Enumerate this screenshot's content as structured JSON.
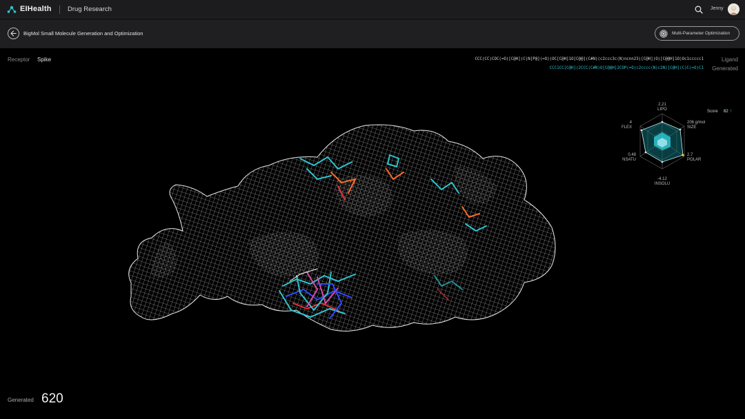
{
  "header": {
    "brand": "EIHealth",
    "app_name": "Drug Research",
    "user_name": "Jenny"
  },
  "subheader": {
    "title": "BigMol Small Molecule Generation and Optimization",
    "mpo_button_label": "Multi-Parameter Optimization"
  },
  "receptor": {
    "label": "Receptor",
    "value": "Spike"
  },
  "smiles": {
    "ligand": "CCC(CC)COC(=O)[C@H](C)N[P@](=O)(OC[C@H]1O[C@@](C#N)(c2ccc3c(N)ncnn23)[C@H](O)[C@@H]1O)Oc1ccccc1",
    "ligand_label": "Ligand",
    "generated": "CCC1CC[C@H](2CCC(C#N)O[C@@H]2COP(=O)c2cccc(N)c2N)[C@H](C)C(=O)C1",
    "generated_label": "Generated"
  },
  "properties": {
    "lipo": {
      "label": "LIPO",
      "value": "2.21"
    },
    "size": {
      "label": "SIZE",
      "value": "206 g/mol"
    },
    "polar": {
      "label": "POLAR",
      "value": "2.7"
    },
    "insolu": {
      "label": "INSOLU",
      "value": "-4.12"
    },
    "nsatu": {
      "label": "NSATU",
      "value": "0.48"
    },
    "flex": {
      "label": "FLEX",
      "value": "4"
    }
  },
  "score": {
    "label": "Score",
    "value": "82"
  },
  "generated": {
    "label": "Generated",
    "count": "620"
  },
  "colors": {
    "accent": "#2ec4cf",
    "ligand_orange": "#ff6a2a",
    "ligand_red": "#e8303a",
    "ligand_blue": "#2f4bff",
    "mesh": "#cfcfcf"
  },
  "icons": {
    "logo": "molecule-logo-icon",
    "search": "search-icon",
    "back": "arrow-left-icon",
    "mpo": "hexagon-settings-icon"
  }
}
